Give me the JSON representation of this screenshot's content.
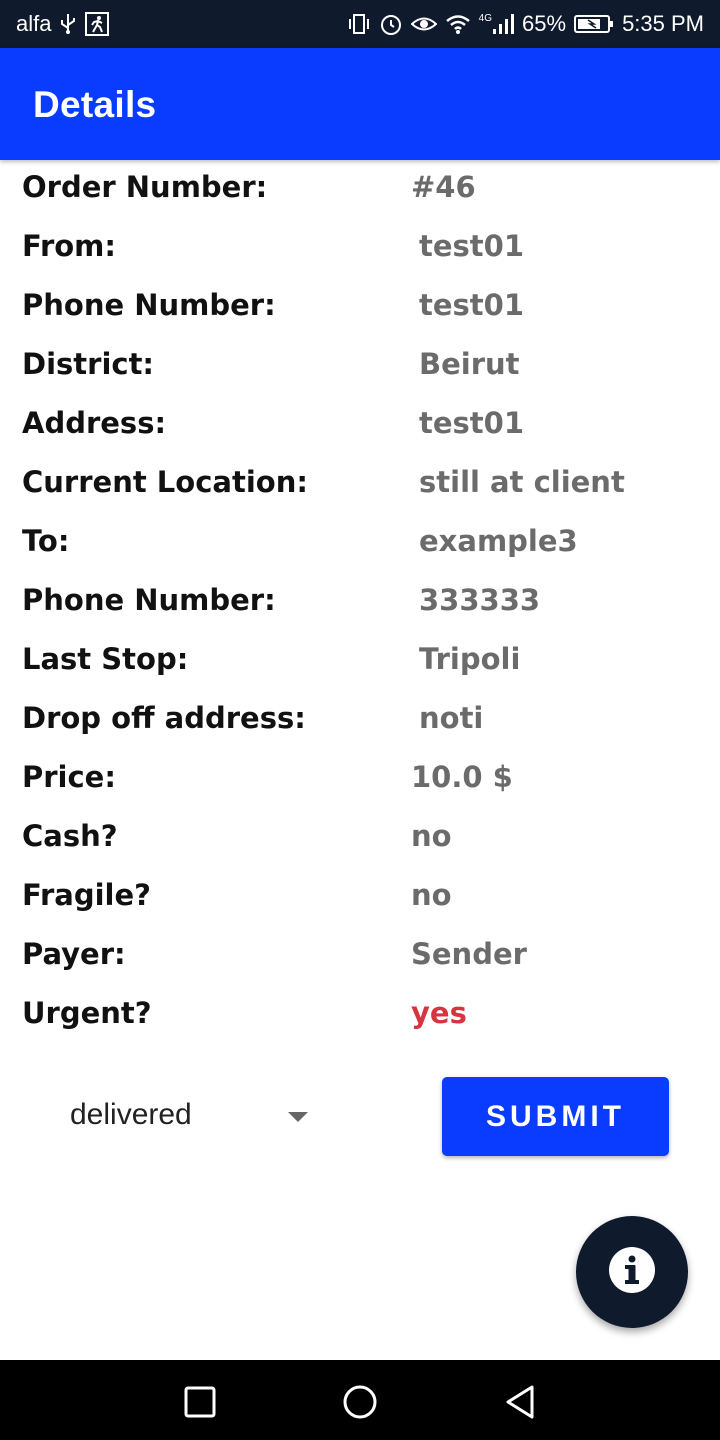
{
  "status_bar": {
    "carrier": "alfa",
    "network": "4G",
    "battery": "65%",
    "time": "5:35 PM",
    "left_icons": [
      "usb-icon",
      "running-person-icon"
    ],
    "right_icons": [
      "vibrate-icon",
      "alarm-icon",
      "eye-icon",
      "wifi-icon",
      "signal-icon",
      "battery-icon"
    ]
  },
  "app_bar": {
    "title": "Details"
  },
  "details": [
    {
      "label": "Order Number:",
      "value": "#46"
    },
    {
      "label": "From:",
      "value": "test01"
    },
    {
      "label": "Phone Number:",
      "value": "test01"
    },
    {
      "label": "District:",
      "value": "Beirut"
    },
    {
      "label": "Address:",
      "value": "test01"
    },
    {
      "label": "Current Location:",
      "value": "still at client"
    },
    {
      "label": "To:",
      "value": "example3"
    },
    {
      "label": "Phone Number:",
      "value": "333333"
    },
    {
      "label": "Last Stop:",
      "value": "Tripoli"
    },
    {
      "label": "Drop off address:",
      "value": "noti"
    },
    {
      "label": "Price:",
      "value": "10.0 $"
    },
    {
      "label": "Cash?",
      "value": "no"
    },
    {
      "label": "Fragile?",
      "value": "no"
    },
    {
      "label": "Payer:",
      "value": "Sender"
    },
    {
      "label": "Urgent?",
      "value": "yes"
    }
  ],
  "controls": {
    "status_select": "delivered",
    "submit_label": "SUBMIT",
    "fab_icon": "info-icon"
  },
  "nav_bar": {
    "buttons": [
      "recents-square-icon",
      "home-circle-icon",
      "back-triangle-icon"
    ]
  },
  "colors": {
    "primary": "#0a3cff",
    "status_bar": "#0f1b2d",
    "value_text": "#6b6b6b",
    "urgent_text": "#d63540"
  }
}
